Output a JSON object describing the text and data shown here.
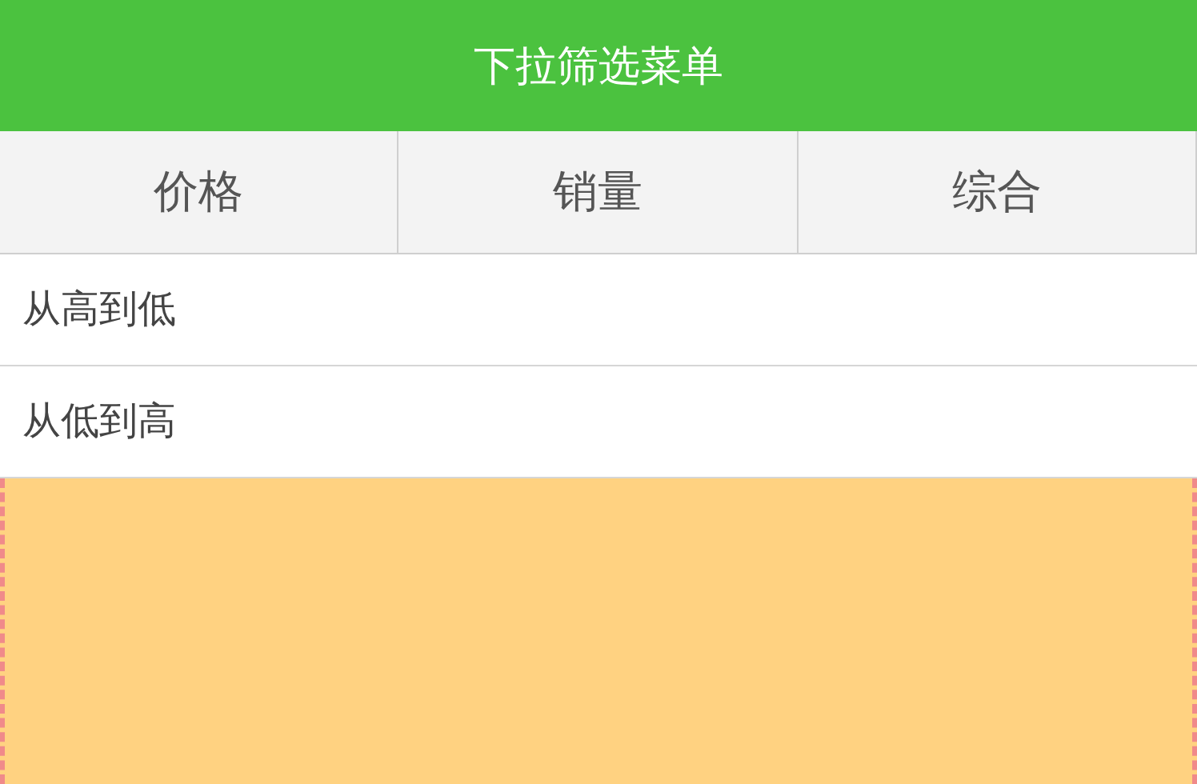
{
  "header": {
    "title": "下拉筛选菜单"
  },
  "tabs": [
    {
      "label": "价格"
    },
    {
      "label": "销量"
    },
    {
      "label": "综合"
    }
  ],
  "options": [
    {
      "label": "从高到低"
    },
    {
      "label": "从低到高"
    }
  ]
}
